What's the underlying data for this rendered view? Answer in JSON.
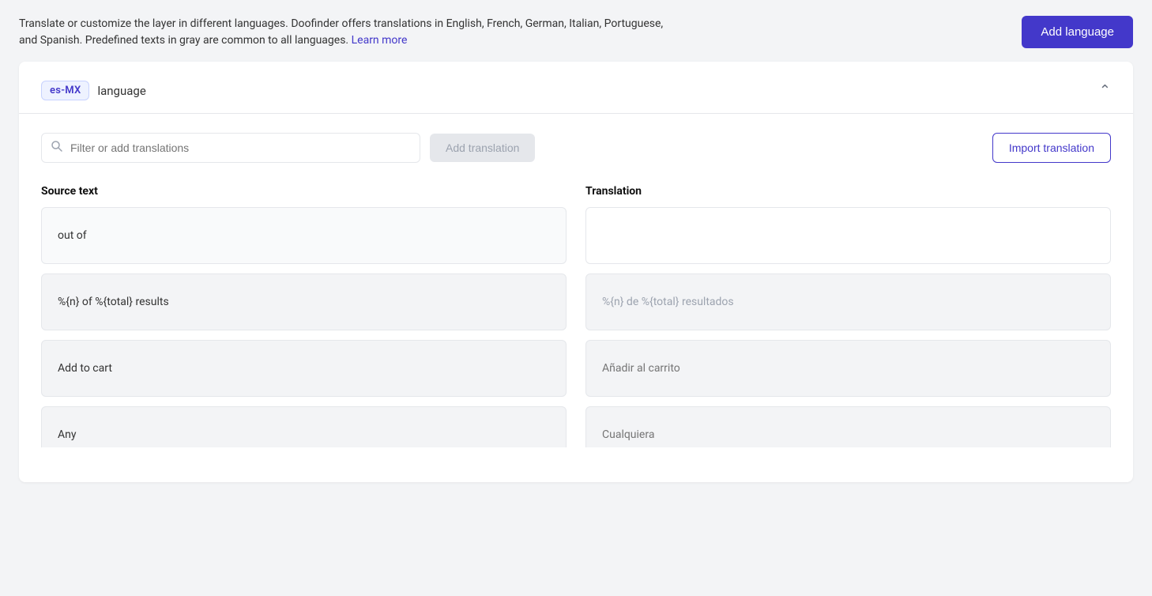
{
  "topbar": {
    "description": "Translate or customize the layer in different languages. Doofinder offers translations in English, French, German, Italian, Portuguese, and Spanish. Predefined texts in gray are common to all languages.",
    "learn_more_link": "Learn more",
    "add_language_btn": "Add language"
  },
  "card": {
    "language_code": "es-MX",
    "language_label": "language",
    "filter_placeholder": "Filter or add translations",
    "add_translation_btn": "Add translation",
    "import_translation_btn": "Import translation",
    "columns": {
      "source": "Source text",
      "translation": "Translation"
    },
    "rows": [
      {
        "id": "out-of",
        "source": "out of",
        "translation": "",
        "translation_placeholder": "",
        "highlighted": false
      },
      {
        "id": "n-of-total-results",
        "source": "%{n} of %{total} results",
        "translation": "%{n} de %{total} resultados",
        "translation_placeholder": "%{n} de %{total} resultados",
        "highlighted": true
      },
      {
        "id": "add-to-cart",
        "source": "Add to cart",
        "translation": "Añadir al carrito",
        "translation_placeholder": "Añadir al carrito",
        "highlighted": true
      },
      {
        "id": "any",
        "source": "Any",
        "translation": "Cualquiera",
        "translation_placeholder": "Cualquiera",
        "highlighted": true,
        "partial": true
      }
    ]
  }
}
